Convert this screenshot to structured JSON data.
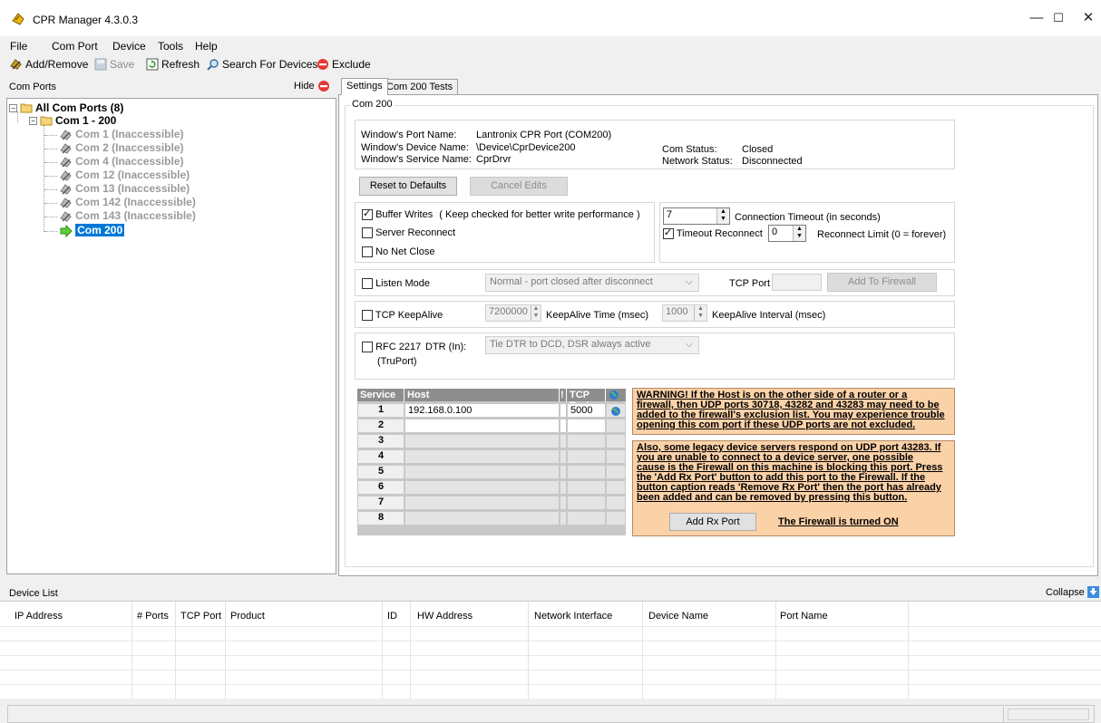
{
  "window": {
    "title": "CPR Manager 4.3.0.3"
  },
  "menu": [
    "File",
    "Com Port",
    "Device",
    "Tools",
    "Help"
  ],
  "toolbar": {
    "add_remove": "Add/Remove",
    "save": "Save",
    "refresh": "Refresh",
    "search": "Search For Devices",
    "exclude": "Exclude"
  },
  "left": {
    "header": "Com Ports",
    "hide": "Hide",
    "tree": {
      "root": "All Com Ports (8)",
      "group": "Com 1 - 200",
      "items": [
        "Com 1 (Inaccessible)",
        "Com 2 (Inaccessible)",
        "Com 4 (Inaccessible)",
        "Com 12 (Inaccessible)",
        "Com 13 (Inaccessible)",
        "Com 142 (Inaccessible)",
        "Com 143 (Inaccessible)"
      ],
      "selected": "Com 200"
    }
  },
  "tabs": [
    "Settings",
    "Com 200 Tests"
  ],
  "settings": {
    "group_title": "Com 200",
    "info": {
      "port_name_label": "Window's Port Name:",
      "port_name": "Lantronix CPR Port (COM200)",
      "device_name_label": "Window's Device Name:",
      "device_name": "\\Device\\CprDevice200",
      "service_name_label": "Window's Service Name:",
      "service_name": "CprDrvr",
      "com_status_label": "Com Status:",
      "com_status": "Closed",
      "net_status_label": "Network Status:",
      "net_status": "Disconnected"
    },
    "reset_button": "Reset to Defaults",
    "cancel_button": "Cancel Edits",
    "buffer_writes": "Buffer Writes",
    "buffer_writes_note": "( Keep checked for better write performance )",
    "server_reconnect": "Server Reconnect",
    "no_net_close": "No Net Close",
    "connection_timeout_value": "7",
    "connection_timeout_label": "Connection Timeout (in seconds)",
    "timeout_reconnect": "Timeout Reconnect",
    "reconnect_limit_value": "0",
    "reconnect_limit_label": "Reconnect Limit (0 = forever)",
    "listen_mode": "Listen Mode",
    "listen_mode_option": "Normal - port closed after disconnect",
    "tcp_port_label": "TCP Port",
    "add_firewall": "Add To Firewall",
    "tcp_keepalive": "TCP KeepAlive",
    "keepalive_time_value": "7200000",
    "keepalive_time_label": "KeepAlive Time (msec)",
    "keepalive_interval_value": "1000",
    "keepalive_interval_label": "KeepAlive Interval (msec)",
    "rfc2217": "RFC 2217",
    "truport": "(TruPort)",
    "dtr_label": "DTR (In):",
    "dtr_option": "Tie DTR to DCD, DSR always active"
  },
  "grid": {
    "headers": [
      "Service",
      "Host",
      "!",
      "TCP Port"
    ],
    "rows": [
      {
        "n": "1",
        "host": "192.168.0.100",
        "port": "5000"
      },
      {
        "n": "2",
        "host": "",
        "port": ""
      },
      {
        "n": "3",
        "host": "",
        "port": ""
      },
      {
        "n": "4",
        "host": "",
        "port": ""
      },
      {
        "n": "5",
        "host": "",
        "port": ""
      },
      {
        "n": "6",
        "host": "",
        "port": ""
      },
      {
        "n": "7",
        "host": "",
        "port": ""
      },
      {
        "n": "8",
        "host": "",
        "port": ""
      }
    ]
  },
  "warning": {
    "lines1": [
      "WARNING! If the Host is on the other side of a router or a",
      "firewall, then UDP ports 30718, 43282 and 43283 may need to be",
      "added to the firewall's exclusion list. You may experience trouble",
      "opening this com port if these UDP ports are not excluded."
    ],
    "lines2": [
      "Also, some legacy device servers respond on UDP port 43283.  If",
      "you are unable to connect to a device server, one possible",
      "cause is the Firewall on this machine is blocking this port.  Press",
      "the 'Add Rx Port' button to add this port to the Firewall.  If the",
      "button caption reads 'Remove Rx Port' then the port has already",
      "been added and can be removed by pressing this button."
    ],
    "add_rx_button": "Add Rx Port",
    "firewall_status": "The Firewall is turned ON"
  },
  "device_list": {
    "header": "Device List",
    "collapse": "Collapse",
    "columns": [
      "IP Address",
      "# Ports",
      "TCP Port",
      "Product",
      "ID",
      "HW Address",
      "Network Interface",
      "Device Name",
      "Port Name"
    ]
  },
  "colors": {
    "selection": "#0078d7",
    "warning_bg": "#fbd1a8",
    "grid_header": "#8e8e8e"
  }
}
